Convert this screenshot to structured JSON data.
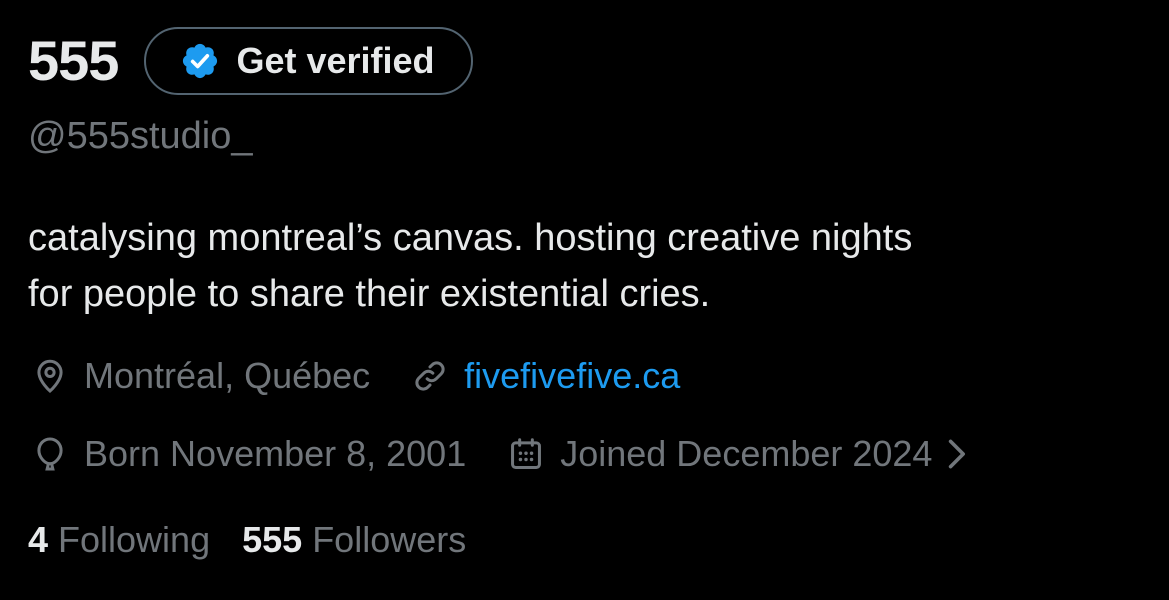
{
  "profile": {
    "display_name": "555",
    "handle": "@555studio_",
    "verify_button_label": "Get verified",
    "bio_lines": [
      "catalysing montreal’s canvas. hosting creative nights",
      "for people to share their existential cries."
    ],
    "location": "Montréal, Québec",
    "website": "fivefivefive.ca",
    "birthday": "Born November 8, 2001",
    "joined": "Joined December 2024",
    "following_count": "4",
    "following_label": "Following",
    "followers_count": "555",
    "followers_label": "Followers"
  },
  "icons": {
    "verified": "verified-badge-icon",
    "location": "location-pin-icon",
    "link": "link-icon",
    "birthday": "balloon-icon",
    "joined": "calendar-icon",
    "chevron": "chevron-right-icon"
  },
  "colors": {
    "background": "#000000",
    "text_primary": "#e7e9ea",
    "text_secondary": "#71767b",
    "accent": "#1d9bf0",
    "border": "#536471"
  }
}
